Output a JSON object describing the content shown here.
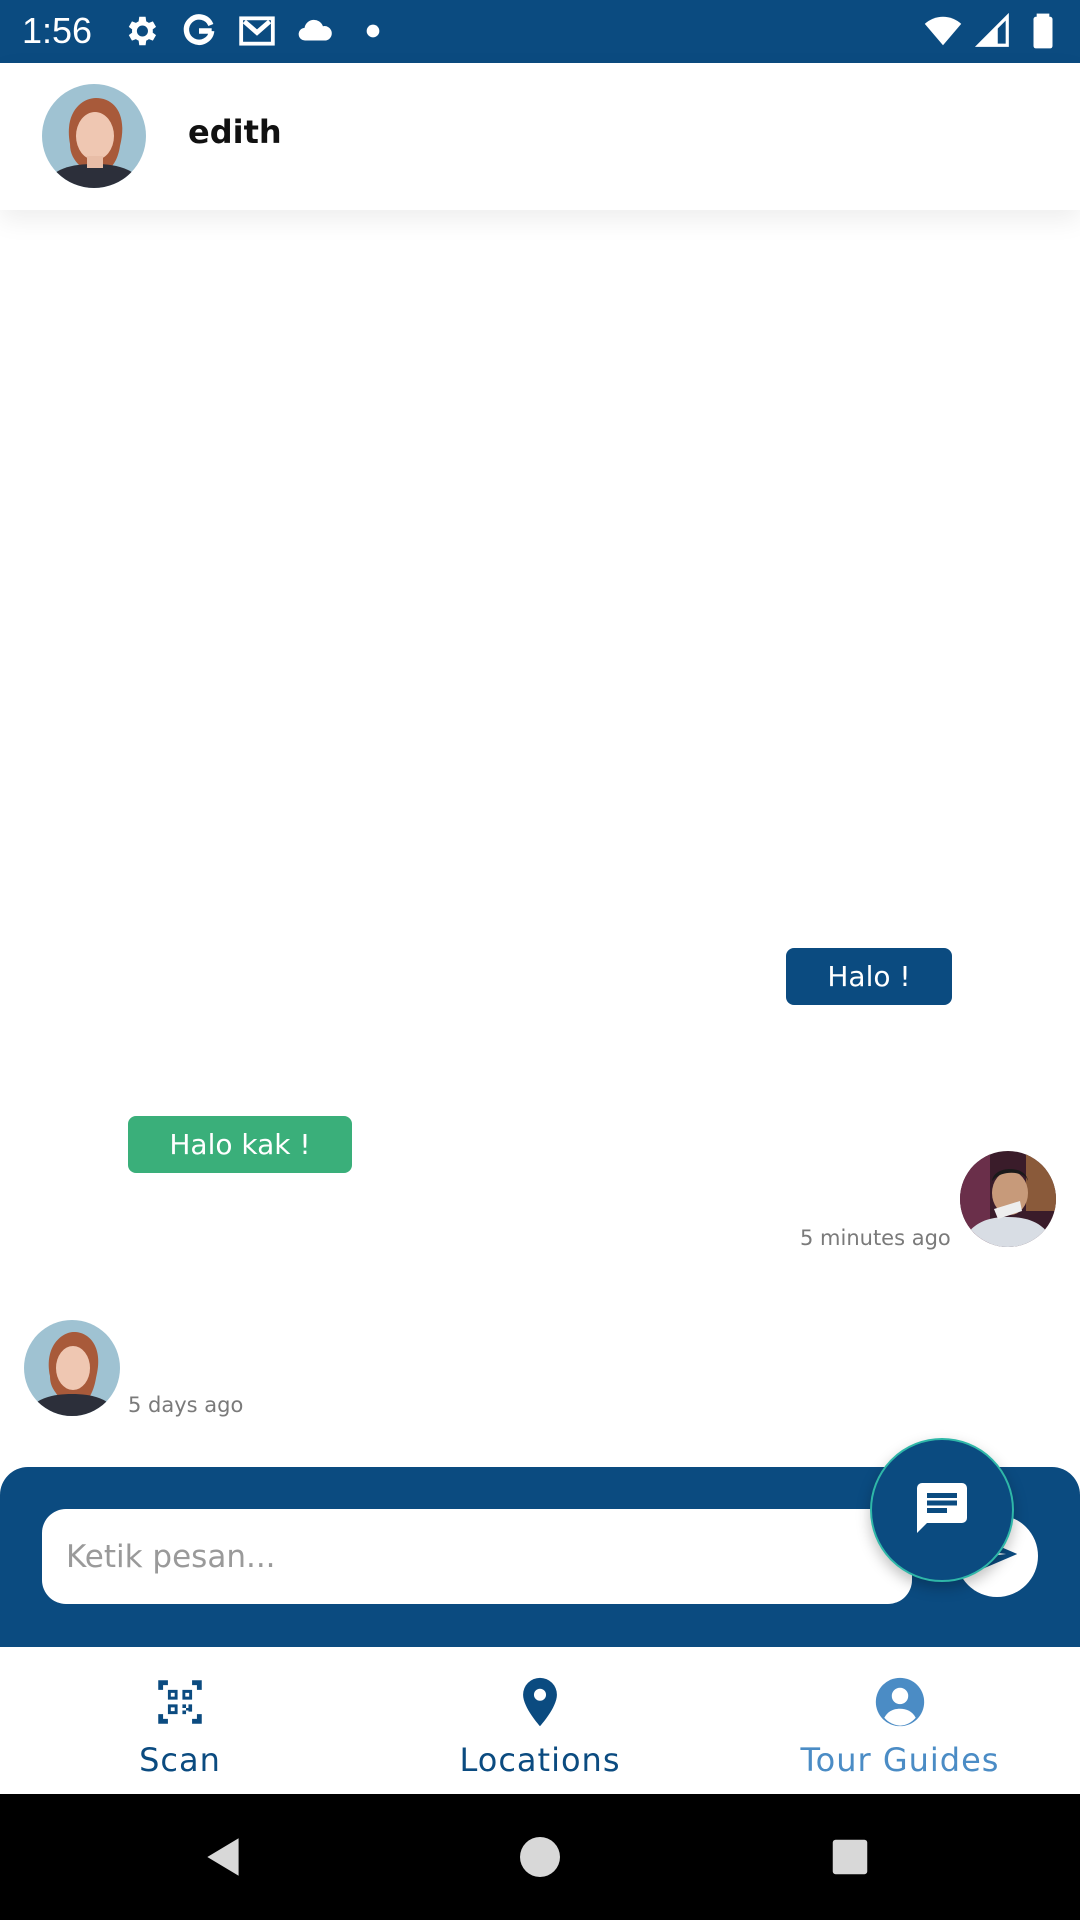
{
  "status_bar": {
    "time": "1:56",
    "icons_left": [
      "gear-icon",
      "google-icon",
      "gmail-icon",
      "cloud-icon",
      "dot-icon"
    ],
    "icons_right": [
      "wifi-icon",
      "signal-icon",
      "battery-icon"
    ]
  },
  "header": {
    "contact_name": "edith",
    "avatar_icon": "contact-avatar"
  },
  "messages": [
    {
      "direction": "outgoing",
      "text": "Halo !",
      "time": "5 minutes ago",
      "bubble_color": "#0b4b80"
    },
    {
      "direction": "incoming",
      "text": "Halo kak !",
      "time": "5 days ago",
      "bubble_color": "#3aaf7a"
    }
  ],
  "composer": {
    "placeholder": "Ketik pesan...",
    "value": "",
    "send_icon": "send-icon",
    "fab_icon": "chat-icon"
  },
  "bottom_nav": {
    "items": [
      {
        "label": "Scan",
        "icon": "qr-scan-icon",
        "active": false
      },
      {
        "label": "Locations",
        "icon": "location-pin-icon",
        "active": false
      },
      {
        "label": "Tour Guides",
        "icon": "person-icon",
        "active": true
      }
    ]
  },
  "system_nav": {
    "icons": [
      "back-icon",
      "home-icon",
      "recents-icon"
    ]
  },
  "colors": {
    "primary": "#0b4b80",
    "incoming_bubble": "#3aaf7a",
    "nav_active": "#4b8cc5",
    "fab_border": "#2fb7a8"
  }
}
